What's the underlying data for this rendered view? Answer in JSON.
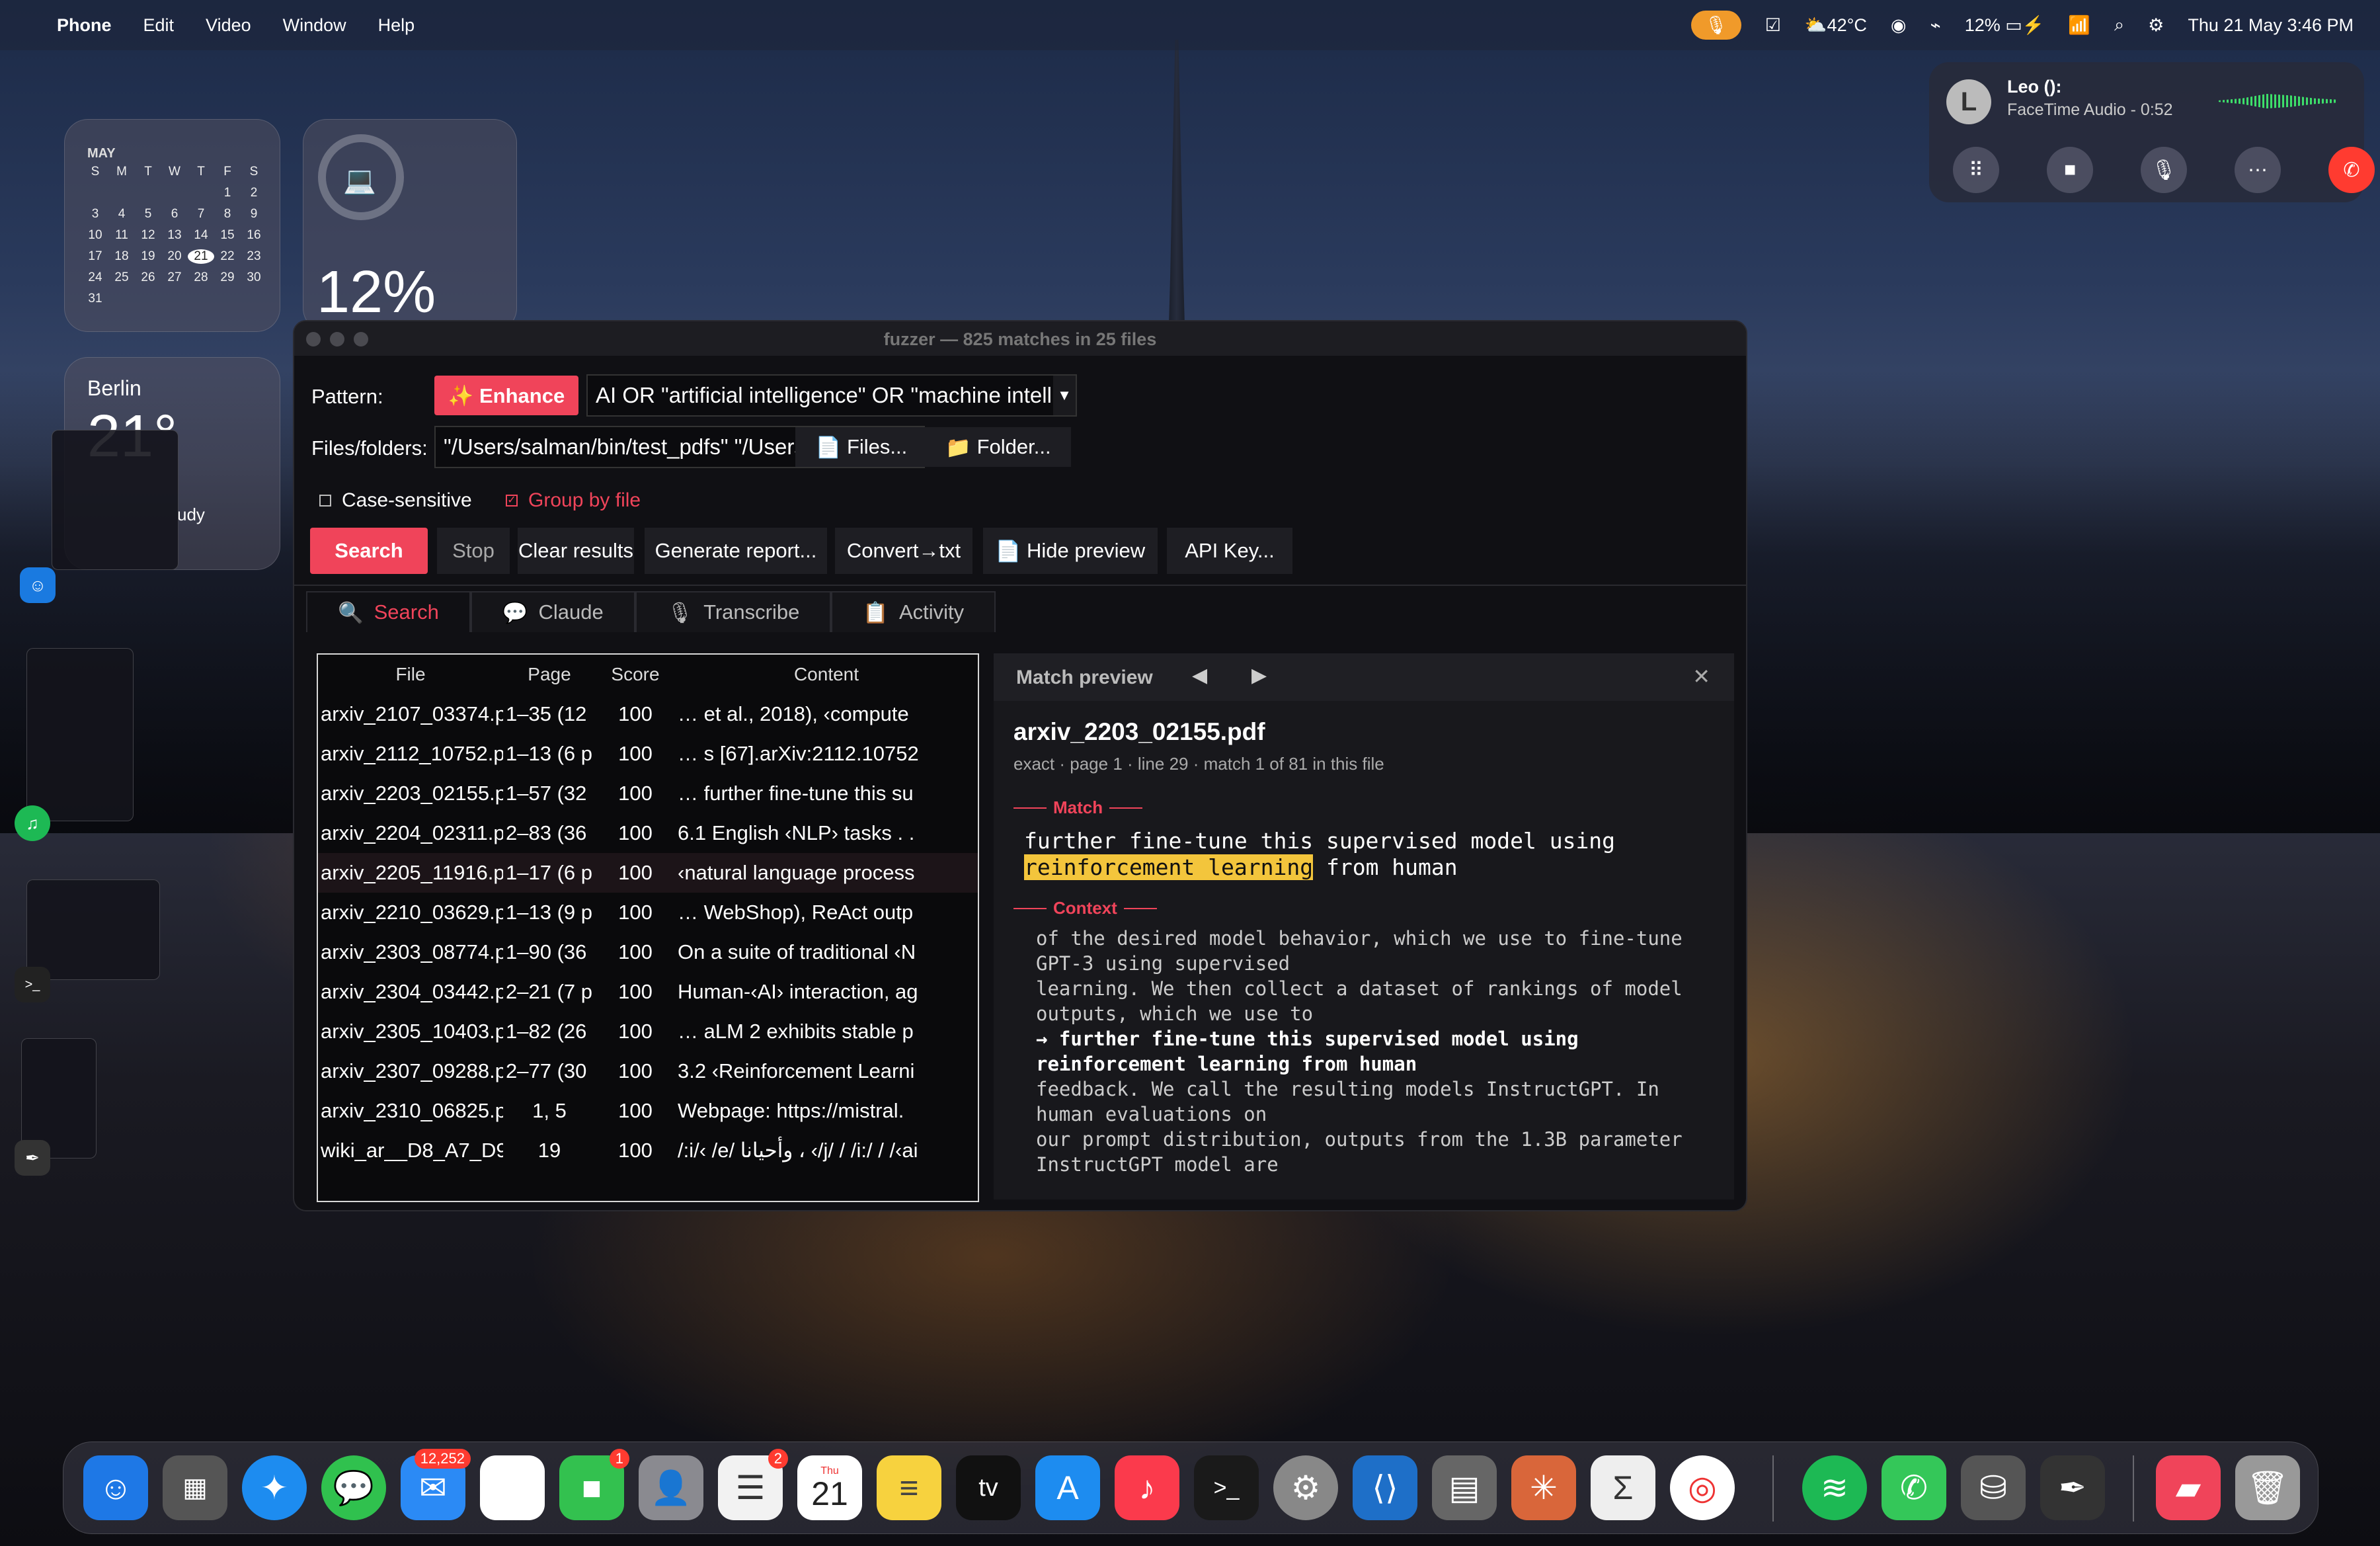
{
  "menubar": {
    "app": "Phone",
    "menus": [
      "Edit",
      "Video",
      "Window",
      "Help"
    ],
    "weather": "42°C",
    "battery": "12%",
    "datetime": "Thu 21 May  3:46 PM"
  },
  "widgets": {
    "calendar": {
      "month": "MAY",
      "weekdays": [
        "S",
        "M",
        "T",
        "W",
        "T",
        "F",
        "S"
      ],
      "days": [
        "",
        "",
        "",
        "",
        "",
        "1",
        "2",
        "3",
        "4",
        "5",
        "6",
        "7",
        "8",
        "9",
        "10",
        "11",
        "12",
        "13",
        "14",
        "15",
        "16",
        "17",
        "18",
        "19",
        "20",
        "21",
        "22",
        "23",
        "24",
        "25",
        "26",
        "27",
        "28",
        "29",
        "30",
        "31"
      ],
      "today": "21"
    },
    "battery": {
      "percent": "12%"
    },
    "weather": {
      "city": "Berlin",
      "temp": "21°",
      "condition": "udy"
    }
  },
  "facetime": {
    "initial": "L",
    "name": "Leo ():",
    "status": "FaceTime Audio -  0:52"
  },
  "window": {
    "title": "fuzzer — 825 matches in 25 files",
    "pattern_label": "Pattern:",
    "enhance_label": "✨ Enhance",
    "pattern_value": "AI OR \"artificial intelligence\" OR \"machine intelligence\" OR \"computational intellig",
    "files_label": "Files/folders:",
    "files_value": "\"/Users/salman/bin/test_pdfs\" \"/Users/salman/Documents/KING SAUD UNIVERSITY.pdf\"",
    "files_btn": "Files...",
    "folder_btn": "Folder...",
    "case_sensitive": "Case-sensitive",
    "group_by_file": "Group by file",
    "buttons": {
      "search": "Search",
      "stop": "Stop",
      "clear": "Clear results",
      "report": "Generate report...",
      "convert": "Convert→txt",
      "hide_preview": "Hide preview",
      "api_key": "API Key..."
    },
    "tabs": [
      "Search",
      "Claude",
      "Transcribe",
      "Activity"
    ],
    "table": {
      "headers": [
        "File",
        "Page",
        "Score",
        "Content"
      ],
      "rows": [
        [
          "arxiv_2107_03374.p",
          "1–35 (12",
          "100",
          "… et al., 2018), ‹compute"
        ],
        [
          "arxiv_2112_10752.p",
          "1–13 (6 p",
          "100",
          "… s [67].arXiv:2112.10752"
        ],
        [
          "arxiv_2203_02155.p",
          "1–57 (32",
          "100",
          "… further fine-tune this su"
        ],
        [
          "arxiv_2204_02311.p",
          "2–83 (36",
          "100",
          "6.1 English ‹NLP› tasks . ."
        ],
        [
          "arxiv_2205_11916.p",
          "1–17 (6 p",
          "100",
          "‹natural language process"
        ],
        [
          "arxiv_2210_03629.p",
          "1–13 (9 p",
          "100",
          "… WebShop), ReAct outp"
        ],
        [
          "arxiv_2303_08774.p",
          "1–90 (36",
          "100",
          "On a suite of traditional ‹N"
        ],
        [
          "arxiv_2304_03442.p",
          "2–21 (7 p",
          "100",
          "Human-‹AI› interaction, ag"
        ],
        [
          "arxiv_2305_10403.p",
          "1–82 (26",
          "100",
          "… aLM 2 exhibits stable p"
        ],
        [
          "arxiv_2307_09288.p",
          "2–77 (30",
          "100",
          "3.2 ‹Reinforcement Learni"
        ],
        [
          "arxiv_2310_06825.p",
          "1, 5",
          "100",
          "Webpage: https://mistral."
        ],
        [
          "wiki_ar__D8_A7_D9",
          "19",
          "100",
          "/:i/‹ /e/ وأحيانا ، ‹/j/ / /i:/ / /‹ai"
        ]
      ]
    },
    "preview": {
      "title": "Match preview",
      "file": "arxiv_2203_02155.pdf",
      "meta": "exact · page 1 · line 29 · match 1 of 81 in this file",
      "match_label": "Match",
      "match_line1": "further fine-tune this supervised model using",
      "match_hl": "reinforcement learning",
      "match_rest": " from human",
      "context_label": "Context",
      "context_lines": [
        "of the desired model behavior, which we use to fine-tune",
        "GPT-3 using supervised",
        "learning. We then collect a dataset of rankings of model",
        "outputs, which we use to"
      ],
      "context_bold1": "→ further fine-tune this supervised model using",
      "context_bold2": "reinforcement learning from human",
      "context_after": [
        "feedback. We call the resulting models InstructGPT. In",
        "human evaluations on",
        "our prompt distribution, outputs from the 1.3B parameter",
        "InstructGPT model are"
      ]
    }
  },
  "dock": {
    "mail_badge": "12,252",
    "facetime_badge": "1",
    "reminders_badge": "2",
    "calendar_day": "Thu",
    "calendar_date": "21",
    "tv_label": "tv",
    "terminal_label": ">_"
  }
}
